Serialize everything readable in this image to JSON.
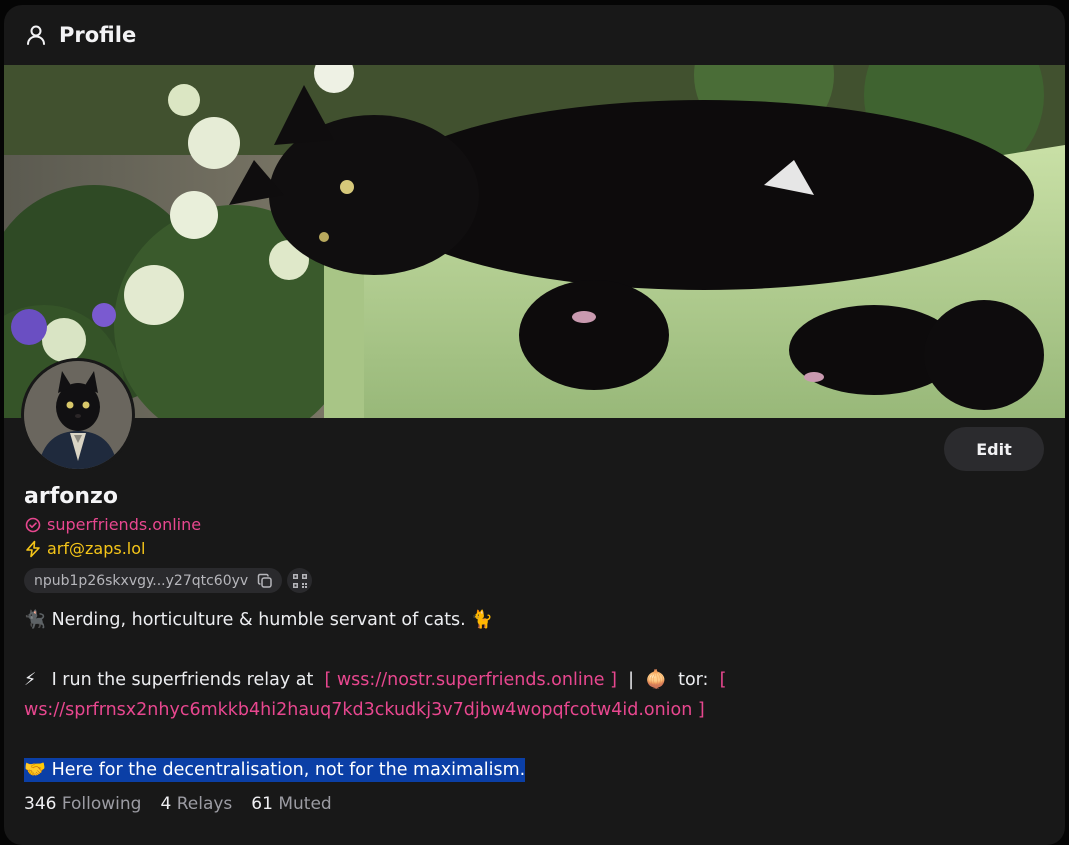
{
  "header": {
    "title": "Profile",
    "icon": "user-icon"
  },
  "profile": {
    "name": "arfonzo",
    "nip05": "superfriends.online",
    "lud16": "arf@zaps.lol",
    "npub": "npub1p26skxvgy...y27qtc60yv",
    "edit_label": "Edit"
  },
  "about": {
    "line1_emoji": "🐈‍⬛",
    "line1_text": "Nerding, horticulture & humble servant of cats.",
    "line1_emoji_end": "🐈",
    "line2_emoji": "⚡",
    "line2_text": "I run the superfriends relay at",
    "relay_url": "[ wss://nostr.superfriends.online ]",
    "separator": "|",
    "tor_emoji": "🧅",
    "tor_label": "tor:",
    "tor_url": "[ ws://sprfrnsx2nhyc6mkkb4hi2hauq7kd3ckudkj3v7djbw4wopqfcotw4id.onion ]",
    "line3_emoji": "🤝",
    "line3_text": "Here for the decentralisation, not for the maximalism."
  },
  "stats": {
    "following_count": "346",
    "following_label": "Following",
    "relays_count": "4",
    "relays_label": "Relays",
    "muted_count": "61",
    "muted_label": "Muted"
  },
  "colors": {
    "accent_pink": "#e8478f",
    "zap_yellow": "#f5c518",
    "highlight_blue": "#0b3fa6",
    "panel_bg": "#181818"
  }
}
